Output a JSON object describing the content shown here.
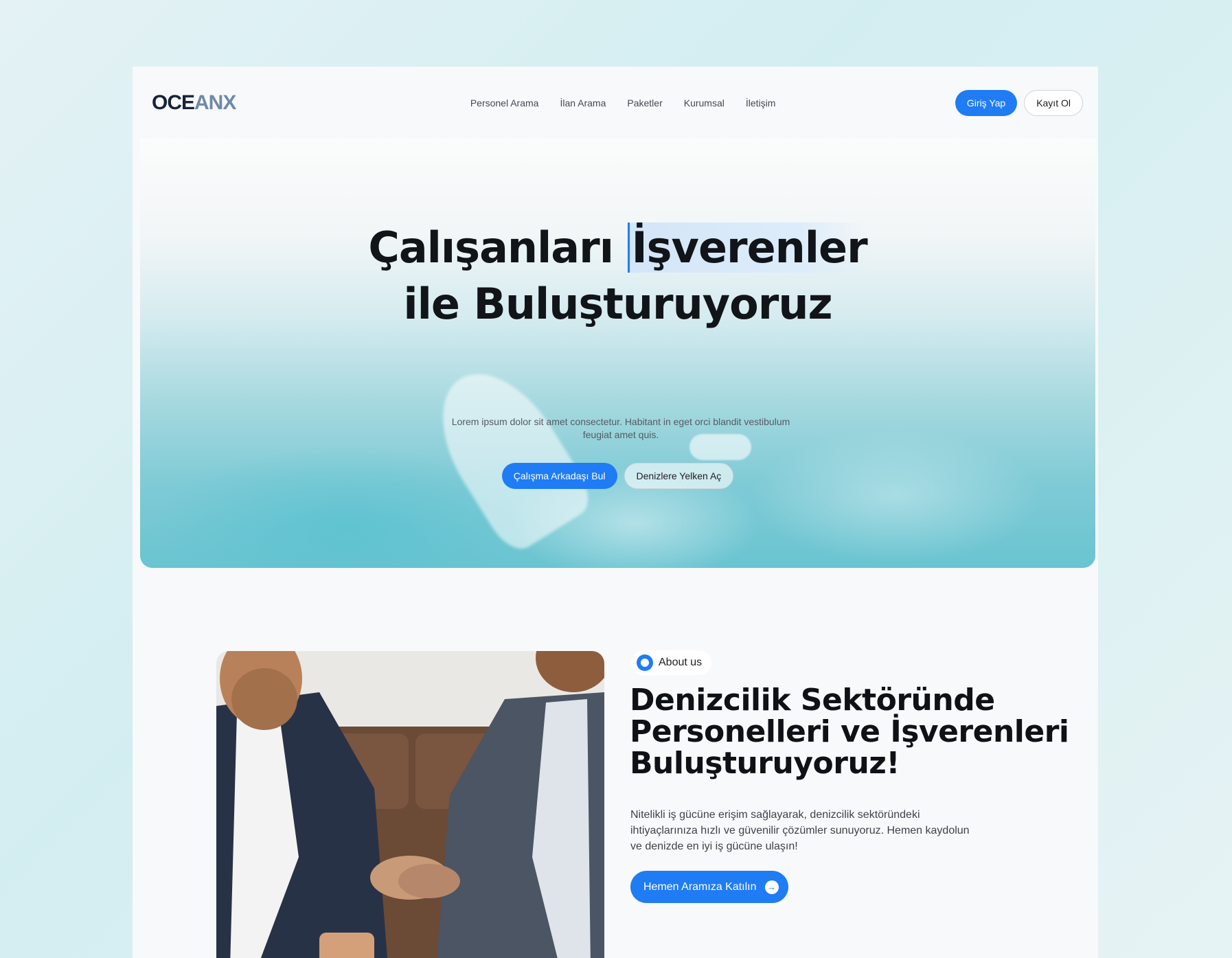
{
  "brand": {
    "logo_dark": "OCE",
    "logo_light": "ANX"
  },
  "nav": {
    "items": [
      "Personel Arama",
      "İlan Arama",
      "Paketler",
      "Kurumsal",
      "İletişim"
    ],
    "login": "Giriş Yap",
    "register": "Kayıt Ol"
  },
  "hero": {
    "title_part1": "Çalışanları ",
    "title_highlight": "İşverenler",
    "title_line2": "ile Buluşturuyoruz",
    "subtitle": "Lorem ipsum dolor sit amet consectetur. Habitant in eget orci blandit vestibulum feugiat amet quis.",
    "primary_cta": "Çalışma Arkadaşı Bul",
    "secondary_cta": "Denizlere Yelken Aç"
  },
  "about": {
    "badge": "About us",
    "title": "Denizcilik Sektöründe Personelleri ve İşverenleri Buluşturuyoruz!",
    "text": "Nitelikli iş gücüne erişim sağlayarak, denizcilik sektöründeki ihtiyaçlarınıza hızlı ve güvenilir çözümler sunuyoruz. Hemen kaydolun ve denizde en iyi iş gücüne ulaşın!",
    "cta": "Hemen Aramıza Katılın"
  },
  "colors": {
    "accent": "#1f7cf4",
    "text_dark": "#111418"
  }
}
